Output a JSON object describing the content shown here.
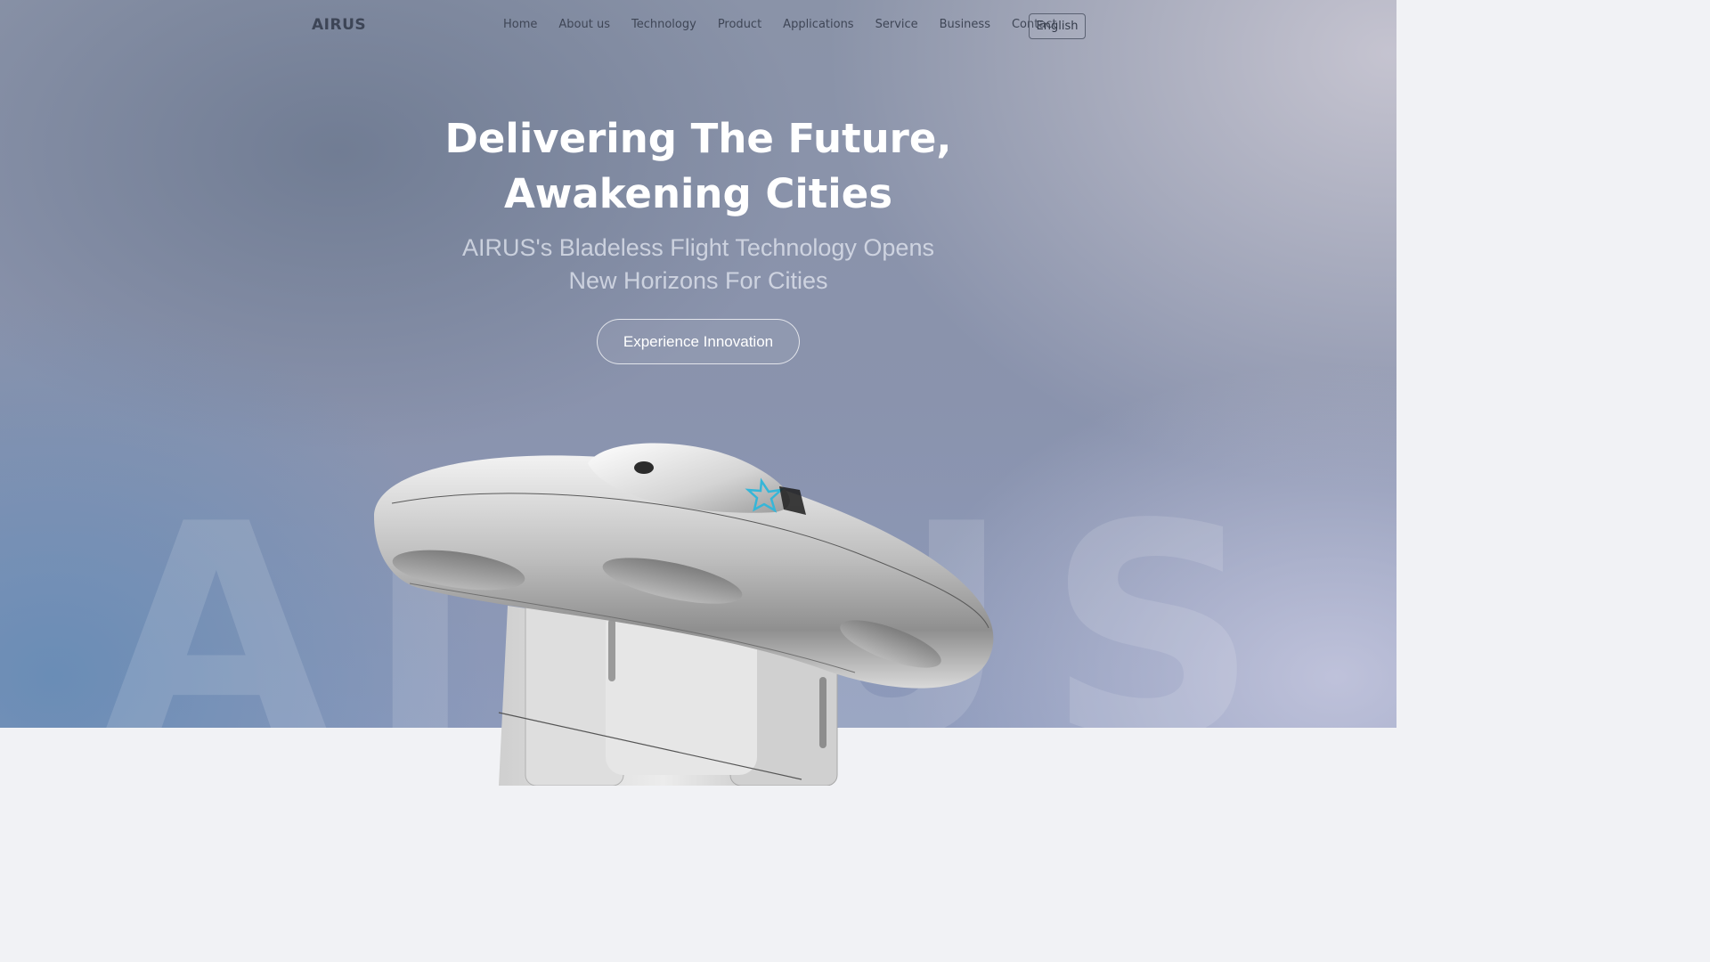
{
  "nav": {
    "logo": "AIRUS",
    "links": [
      "Home",
      "About us",
      "Technology",
      "Product",
      "Applications",
      "Service",
      "Business",
      "Contact"
    ],
    "language": "English"
  },
  "hero": {
    "headline_line1": "Delivering The Future,",
    "headline_line2": "Awakening Cities",
    "subline_line1": "AIRUS's Bladeless Flight Technology Opens",
    "subline_line2": "New Horizons For Cities",
    "cta_label": "Experience Innovation",
    "watermark": "AIRUS"
  },
  "colors": {
    "headline": "#ffffff",
    "nav_text": "#3f4656",
    "footer_bg": "#f1f2f5"
  },
  "icons": {
    "product_image": "bladeless-drone-image"
  }
}
